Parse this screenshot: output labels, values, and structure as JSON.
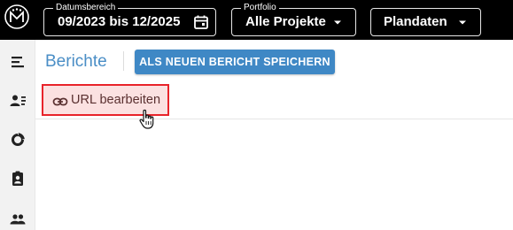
{
  "header": {
    "date_range": {
      "legend": "Datumsbereich",
      "value": "09/2023 bis 12/2025"
    },
    "portfolio": {
      "legend": "Portfolio",
      "value": "Alle Projekte"
    },
    "data_select": {
      "value": "Plandaten"
    }
  },
  "sidebar": {
    "icons": [
      "list-icon",
      "user-list-icon",
      "donut-chart-icon",
      "badge-icon",
      "people-icon"
    ]
  },
  "main": {
    "title": "Berichte",
    "save_button": "ALS NEUEN BERICHT SPEICHERN",
    "edit_url_button": "URL bearbeiten"
  },
  "colors": {
    "accent": "#3f88c5",
    "title": "#4a8ec6",
    "highlight_border": "#e8232a",
    "highlight_fill": "#fbe1e1"
  }
}
